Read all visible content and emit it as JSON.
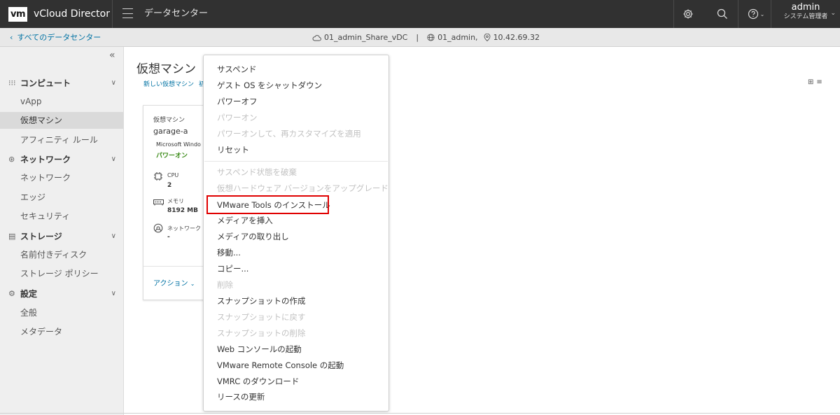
{
  "header": {
    "logo": "vm",
    "app_title": "vCloud Director",
    "nav_label": "データセンター",
    "user": {
      "name": "admin",
      "role": "システム管理者"
    }
  },
  "subheader": {
    "back_label": "すべてのデータセンター",
    "vdc": "01_admin_Share_vDC",
    "separator": "|",
    "org": "01_admin,",
    "ip": "10.42.69.32"
  },
  "sidebar": {
    "collapse": "«",
    "groups": [
      {
        "label": "コンピュート",
        "items": [
          "vApp",
          "仮想マシン",
          "アフィニティ ルール"
        ]
      },
      {
        "label": "ネットワーク",
        "items": [
          "ネットワーク",
          "エッジ",
          "セキュリティ"
        ]
      },
      {
        "label": "ストレージ",
        "items": [
          "名前付きディスク",
          "ストレージ ポリシー"
        ]
      },
      {
        "label": "設定",
        "items": [
          "全般",
          "メタデータ"
        ]
      }
    ],
    "active_item": "仮想マシン"
  },
  "main": {
    "title": "仮想マシン",
    "new_vm_link": "新しい仮想マシン",
    "link_fragment": "初"
  },
  "vm_card": {
    "type_label": "仮想マシン",
    "name": "garage-a",
    "os": "Microsoft Windo",
    "power_state": "パワーオン",
    "cpu_label": "CPU",
    "cpu_value": "2",
    "memory_label": "メモリ",
    "memory_value": "8192 MB",
    "network_label": "ネットワーク",
    "network_value": "-",
    "actions_label": "アクション"
  },
  "menu": {
    "items": [
      {
        "label": "サスペンド",
        "enabled": true
      },
      {
        "label": "ゲスト OS をシャットダウン",
        "enabled": true
      },
      {
        "label": "パワーオフ",
        "enabled": true
      },
      {
        "label": "パワーオン",
        "enabled": false
      },
      {
        "label": "パワーオンして、再カスタマイズを適用",
        "enabled": false
      },
      {
        "label": "リセット",
        "enabled": true
      },
      {
        "label": "サスペンド状態を破棄",
        "enabled": false
      },
      {
        "label": "仮想ハードウェア バージョンをアップグレード",
        "enabled": false
      },
      {
        "label": "VMware Tools のインストール",
        "enabled": true,
        "highlighted": true
      },
      {
        "label": "メディアを挿入",
        "enabled": true
      },
      {
        "label": "メディアの取り出し",
        "enabled": true
      },
      {
        "label": "移動...",
        "enabled": true
      },
      {
        "label": "コピー...",
        "enabled": true
      },
      {
        "label": "削除",
        "enabled": false
      },
      {
        "label": "スナップショットの作成",
        "enabled": true
      },
      {
        "label": "スナップショットに戻す",
        "enabled": false
      },
      {
        "label": "スナップショットの削除",
        "enabled": false
      },
      {
        "label": "Web コンソールの起動",
        "enabled": true
      },
      {
        "label": "VMware Remote Console の起動",
        "enabled": true
      },
      {
        "label": "VMRC のダウンロード",
        "enabled": true
      },
      {
        "label": "リースの更新",
        "enabled": true
      }
    ]
  },
  "colors": {
    "header_bg": "#313131",
    "link": "#0072a3",
    "power_on": "#3a8a17",
    "highlight": "#e00000"
  }
}
